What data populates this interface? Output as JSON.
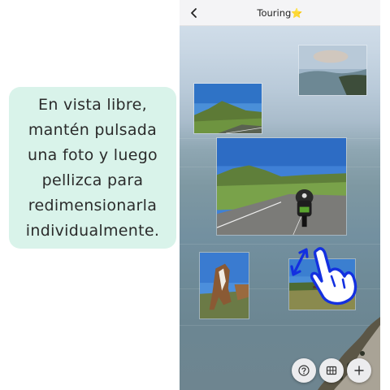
{
  "tip": {
    "lines": [
      "En vista libre,",
      "mantén pulsada",
      "una foto y luego",
      "pellizca para",
      "redimensionarla",
      "individualmente."
    ]
  },
  "header": {
    "title": "Touring⭐"
  },
  "photos": [
    {
      "subject": "sea-coast-view"
    },
    {
      "subject": "green-hills"
    },
    {
      "subject": "motorcycle-road"
    },
    {
      "subject": "horse"
    },
    {
      "subject": "horses-grassland"
    }
  ],
  "icons": {
    "back": "chevron-left-icon",
    "help": "question-circle-icon",
    "layout": "grid-icon",
    "add": "plus-icon",
    "gesture": "pinch-hand-icon"
  },
  "colors": {
    "bubble": "#d9f3ea",
    "gesture": "#1330e0",
    "header": "#f4f4f6"
  }
}
